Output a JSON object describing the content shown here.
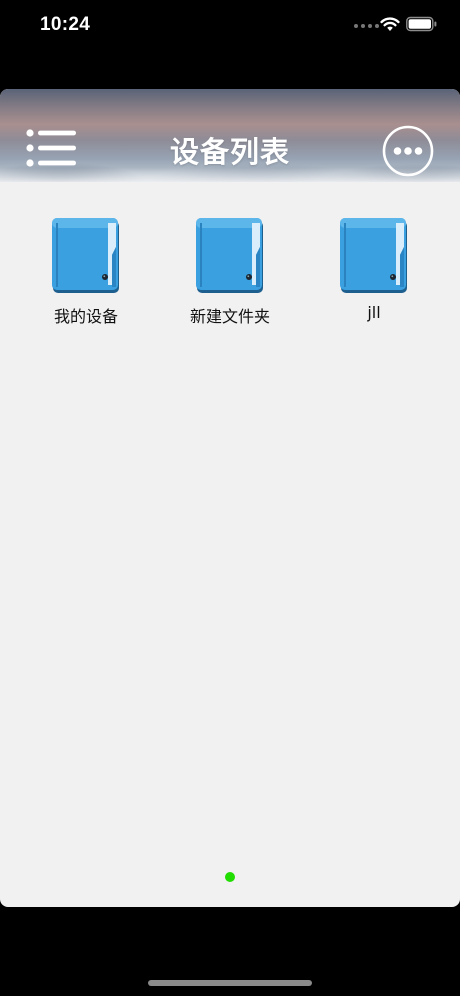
{
  "status_bar": {
    "time": "10:24"
  },
  "header": {
    "title": "设备列表",
    "menu_icon": "list-menu-icon",
    "more_icon": "more-options-icon"
  },
  "folders": [
    {
      "label": "我的设备",
      "icon": "folder-icon"
    },
    {
      "label": "新建文件夹",
      "icon": "folder-icon"
    },
    {
      "label": "jll",
      "icon": "folder-icon"
    }
  ],
  "page_indicator": {
    "pages": 1,
    "current": 1,
    "color": "#22dd00"
  },
  "colors": {
    "folder_blue": "#3aa0e0",
    "background": "#f1f1f1"
  }
}
